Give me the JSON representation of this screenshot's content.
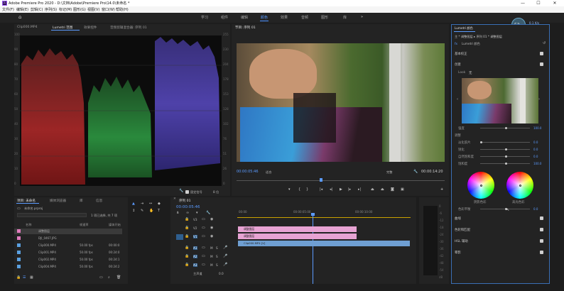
{
  "title_bar": {
    "app_logo": "Pr",
    "title": "Adobe Premiere Pro 2020 - D:\\文档\\Adobe\\Premiere Pro\\14.0\\未命名 *",
    "minimize": "—",
    "maximize": "☐",
    "close": "✕"
  },
  "menu": [
    "文件(F)",
    "编辑(E)",
    "剪辑(C)",
    "序列(S)",
    "标记(M)",
    "图形(G)",
    "视图(V)",
    "窗口(W)",
    "帮助(H)"
  ],
  "workspace": {
    "tabs": [
      "学习",
      "组件",
      "编辑",
      "颜色",
      "效果",
      "音频",
      "图形",
      "库"
    ],
    "active": "颜色",
    "more": "»"
  },
  "indicator": {
    "percent": "52",
    "unit": "%",
    "up": "0.1",
    "up_unit": "K/s",
    "down": "0.4",
    "down_unit": "K/s"
  },
  "scopes_panel": {
    "tabs": [
      "Clip000.MP4",
      "Lumetri 范围",
      "效果控件",
      "音频剪辑混合器: 序列 01"
    ],
    "active": "Lumetri 范围",
    "left_ticks": [
      "100",
      "90",
      "80",
      "70",
      "60",
      "50",
      "40",
      "30",
      "20",
      "10",
      "0"
    ],
    "right_ticks": [
      "255",
      "230",
      "204",
      "178",
      "153",
      "128",
      "102",
      "76",
      "51",
      "26",
      "0"
    ],
    "footer_clamp": "固定信号",
    "footer_bits": "8 位"
  },
  "program_monitor": {
    "title": "节目: 序列 01",
    "timecode": "00:00:05:46",
    "fit": "适合",
    "quality": "完整",
    "duration": "00:00:14:20"
  },
  "project_panel": {
    "tabs": [
      "项目: 未命名",
      "媒体浏览器",
      "库",
      "信息"
    ],
    "active": "项目: 未命名",
    "file": "未命名.prproj",
    "selection": "1 项已选择, 共 7 项",
    "columns": {
      "name": "名称",
      "fps": "帧速率",
      "start": "媒体开始"
    },
    "rows": [
      {
        "name": "调整图层",
        "fps": "",
        "start": "",
        "color": "#e07bbd"
      },
      {
        "name": "DJI_0467.JPG",
        "fps": "",
        "start": "",
        "color": "#e07bbd"
      },
      {
        "name": "Clip000.MP4",
        "fps": "50.00 fps",
        "start": "00:00:0",
        "color": "#5aa0e0"
      },
      {
        "name": "Clip001.MP4",
        "fps": "50.00 fps",
        "start": "00:24:0",
        "color": "#5aa0e0"
      },
      {
        "name": "Clip002.MP4",
        "fps": "50.00 fps",
        "start": "00:24:1",
        "color": "#5aa0e0"
      },
      {
        "name": "Clip004.MP4",
        "fps": "50.00 fps",
        "start": "00:24:2",
        "color": "#5aa0e0"
      }
    ]
  },
  "timeline": {
    "tab": "序列 01",
    "timecode": "00:00:05:46",
    "ruler": [
      "00:00",
      "00:00:05:00",
      "00:00:10:00"
    ],
    "tracks": [
      "V3",
      "V2",
      "V1",
      "A1",
      "A2",
      "A3"
    ],
    "clips": [
      {
        "label": "调整图层",
        "track": "V3"
      },
      {
        "label": "调整图层",
        "track": "V2"
      },
      {
        "label": "Clip000.MP4 [V]",
        "track": "V1"
      }
    ],
    "master": "主声道",
    "master_val": "0.0"
  },
  "audio_meter": {
    "ticks": [
      "0",
      "-6",
      "-12",
      "-18",
      "-24",
      "-30",
      "-36",
      "-42",
      "-48",
      "-54",
      "dB"
    ]
  },
  "lumetri": {
    "title": "Lumetri 颜色",
    "breadcrumb": "主 * 调整图层  ▸  序列 01 * 调整图层",
    "effect": "Lumetri 颜色",
    "sections": {
      "basic": "基本校正",
      "creative": "创意",
      "curves": "曲线",
      "wheels": "色轮和匹配",
      "hsl": "HSL 辅助",
      "vignette": "晕影"
    },
    "look_label": "Look",
    "look_value": "无",
    "intensity": {
      "label": "强度",
      "value": "100.0"
    },
    "adjust": "调整",
    "sliders": [
      {
        "label": "淡化胶片",
        "value": "0.0"
      },
      {
        "label": "锐化",
        "value": "0.0"
      },
      {
        "label": "自然饱和度",
        "value": "0.0"
      },
      {
        "label": "饱和度",
        "value": "100.0"
      }
    ],
    "wheel_shadow": "阴影色彩",
    "wheel_highlight": "高光色彩",
    "tint_balance": {
      "label": "色彩平衡",
      "value": "0.0"
    }
  }
}
